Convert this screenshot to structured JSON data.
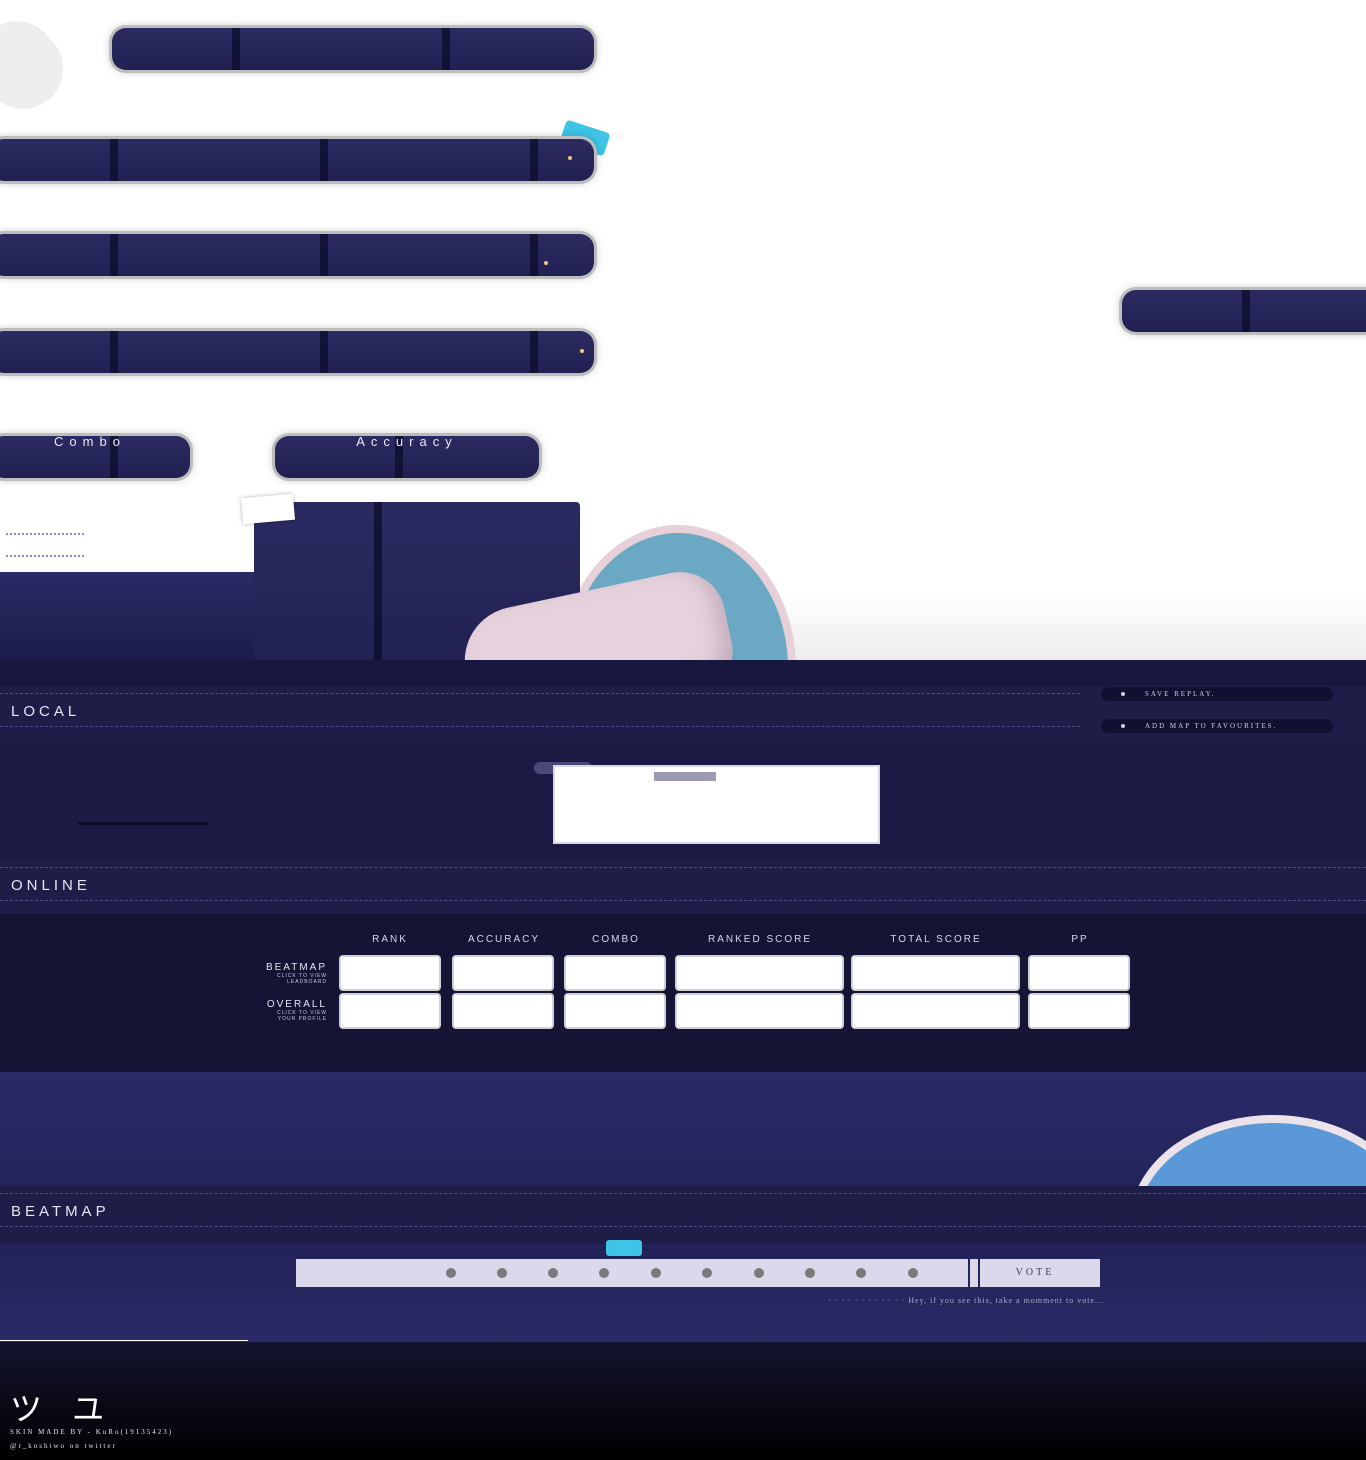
{
  "top_labels": {
    "combo": "Combo",
    "accuracy": "Accuracy"
  },
  "actions": {
    "save_replay": "SAVE REPLAY.",
    "add_favourite": "ADD MAP TO FAVOURITES."
  },
  "sections": {
    "local": "LOCAL",
    "online": "ONLINE",
    "beatmap": "BEATMAP"
  },
  "local_tag": "xxx",
  "online_table": {
    "columns": [
      "RANK",
      "ACCURACY",
      "COMBO",
      "RANKED SCORE",
      "TOTAL SCORE",
      "PP"
    ],
    "rows": [
      {
        "label": "BEATMAP",
        "sub1": "CLICK TO VIEW",
        "sub2": "LEADBOARD"
      },
      {
        "label": "OVERALL",
        "sub1": "CLICK TO VIEW",
        "sub2": "YOUR PROFILE"
      }
    ]
  },
  "vote": {
    "button": "VOTE",
    "hint": "· · · · · · · · · · · ·  Hey, if you see this, take a momment to vote..."
  },
  "credits": {
    "logo": "ツ ユ",
    "made_by": "SKIN MADE BY - KuRo(19135423)",
    "twitter": "@r_koshiwo on twitter"
  },
  "colors": {
    "navy": "#24245c",
    "deep": "#141434",
    "white": "#ffffff"
  }
}
